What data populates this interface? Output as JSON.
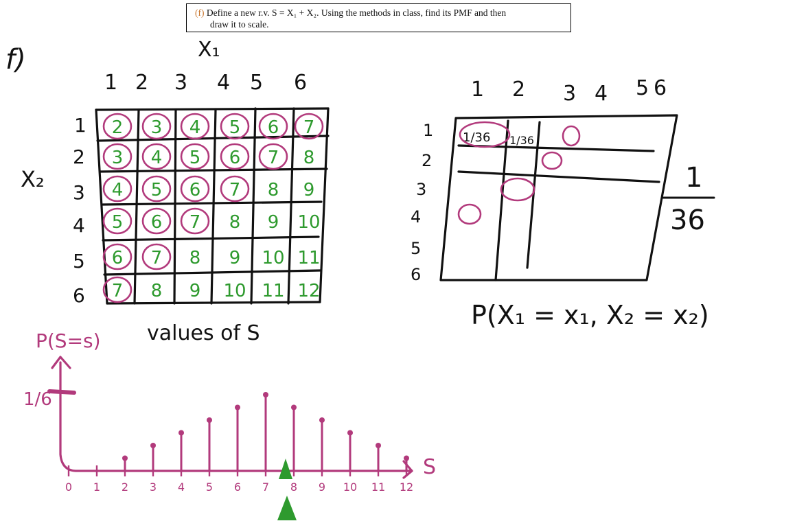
{
  "problem": {
    "label": "(f)",
    "line1": "Define a new r.v. S = X₁ + X₂. Using the methods in class, find its PMF and then",
    "line2": "draw it to scale."
  },
  "notes": {
    "part_label": "f)",
    "x1_label": "X₁",
    "x2_label": "X₂",
    "col_heads": [
      "1",
      "2",
      "3",
      "4",
      "5",
      "6"
    ],
    "row_heads": [
      "1",
      "2",
      "3",
      "4",
      "5",
      "6"
    ],
    "sum_grid": [
      [
        "2",
        "3",
        "4",
        "5",
        "6",
        "7"
      ],
      [
        "3",
        "4",
        "5",
        "6",
        "7",
        "8"
      ],
      [
        "4",
        "5",
        "6",
        "7",
        "8",
        "9"
      ],
      [
        "5",
        "6",
        "7",
        "8",
        "9",
        "10"
      ],
      [
        "6",
        "7",
        "8",
        "9",
        "10",
        "11"
      ],
      [
        "7",
        "8",
        "9",
        "10",
        "11",
        "12"
      ]
    ],
    "grid_caption": "values of S",
    "prob_col_heads": [
      "1",
      "2",
      "3",
      "4",
      "5",
      "6"
    ],
    "prob_row_heads": [
      "1",
      "2",
      "3",
      "4",
      "5",
      "6"
    ],
    "cell_prob": "1/36",
    "fraction_num": "1",
    "fraction_den": "36",
    "joint_caption": "P(X₁ = x₁, X₂ = x₂)",
    "pmf_ylabel": "P(S=s)",
    "pmf_ytick": "1/6",
    "pmf_xlabel": "S",
    "pmf_xticks": [
      "0",
      "1",
      "2",
      "3",
      "4",
      "5",
      "6",
      "7",
      "8",
      "9",
      "10",
      "11",
      "12"
    ]
  },
  "colors": {
    "ink": "#111111",
    "green": "#2e9a2e",
    "magenta": "#b23a7c",
    "orange_label": "#c9762e"
  }
}
